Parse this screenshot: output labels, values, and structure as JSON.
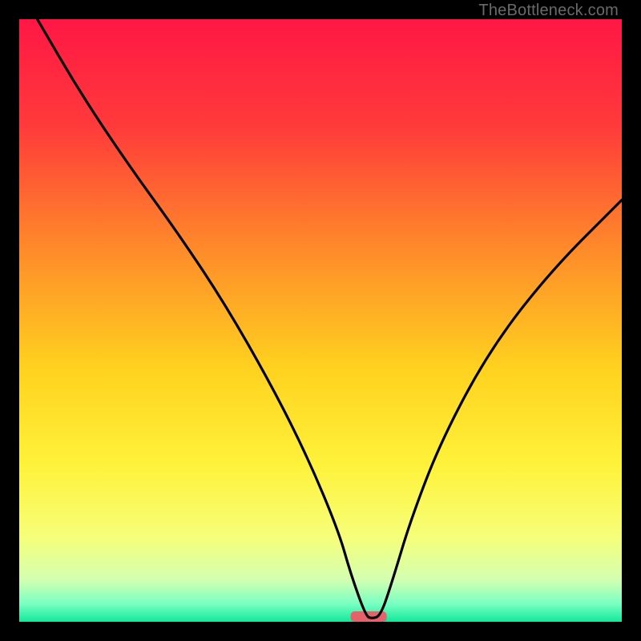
{
  "watermark": "TheBottleneck.com",
  "chart_data": {
    "type": "line",
    "title": "",
    "xlabel": "",
    "ylabel": "",
    "xlim": [
      0,
      100
    ],
    "ylim": [
      0,
      100
    ],
    "grid": false,
    "legend": false,
    "background_gradient": {
      "stops": [
        {
          "pct": 0,
          "color": "#ff1745"
        },
        {
          "pct": 18,
          "color": "#ff3b3a"
        },
        {
          "pct": 38,
          "color": "#ff8a2a"
        },
        {
          "pct": 58,
          "color": "#ffd21f"
        },
        {
          "pct": 74,
          "color": "#fff23a"
        },
        {
          "pct": 86,
          "color": "#f6ff7a"
        },
        {
          "pct": 93,
          "color": "#d4ffb0"
        },
        {
          "pct": 97,
          "color": "#7affc2"
        },
        {
          "pct": 100,
          "color": "#12e89a"
        }
      ]
    },
    "series": [
      {
        "name": "bottleneck-curve",
        "x": [
          3,
          10,
          18,
          26,
          34,
          42,
          48,
          53,
          55,
          57.5,
          58.5,
          60,
          62,
          65,
          70,
          78,
          88,
          100
        ],
        "y": [
          100,
          88,
          76,
          65,
          53,
          39,
          27,
          15,
          8,
          1,
          0.5,
          1,
          7,
          17,
          30,
          45,
          58,
          70
        ]
      }
    ],
    "marker": {
      "name": "min-bar",
      "x_center": 58,
      "width": 6,
      "color": "#e4636b"
    }
  }
}
